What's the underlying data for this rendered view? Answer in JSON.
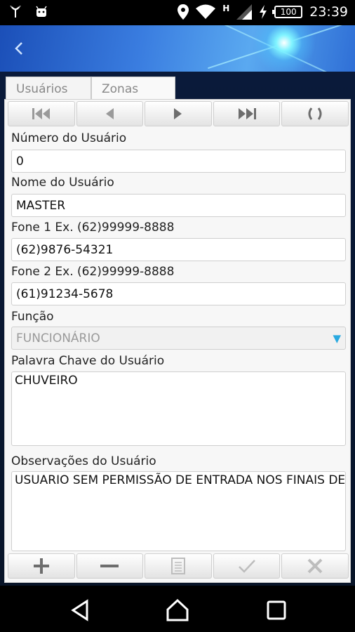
{
  "status_bar": {
    "time": "23:39",
    "battery": "100",
    "network": "H"
  },
  "tabs": [
    {
      "label": "Usuários"
    },
    {
      "label": "Zonas"
    }
  ],
  "nav_buttons": [
    "first-icon",
    "previous-icon",
    "next-icon",
    "last-icon",
    "refresh-icon"
  ],
  "form": {
    "user_number_label": "Número do Usuário",
    "user_number_value": "0",
    "user_name_label": "Nome do Usuário",
    "user_name_value": "MASTER",
    "phone1_label": "Fone 1 Ex. (62)99999-8888",
    "phone1_value": "(62)9876-54321",
    "phone2_label": "Fone 2 Ex. (62)99999-8888",
    "phone2_value": "(61)91234-5678",
    "function_label": "Função",
    "function_value": "FUNCIONÁRIO",
    "keyword_label": "Palavra Chave do Usuário",
    "keyword_value": "CHUVEIRO",
    "notes_label": "Observações do Usuário",
    "notes_value": "USUARIO SEM PERMISSÃO DE ENTRADA NOS FINAIS DE"
  },
  "action_buttons": [
    "add-icon",
    "remove-icon",
    "edit-icon",
    "confirm-icon",
    "cancel-icon"
  ],
  "colors": {
    "accent": "#29a9e0",
    "banner": "#3a7de0"
  }
}
